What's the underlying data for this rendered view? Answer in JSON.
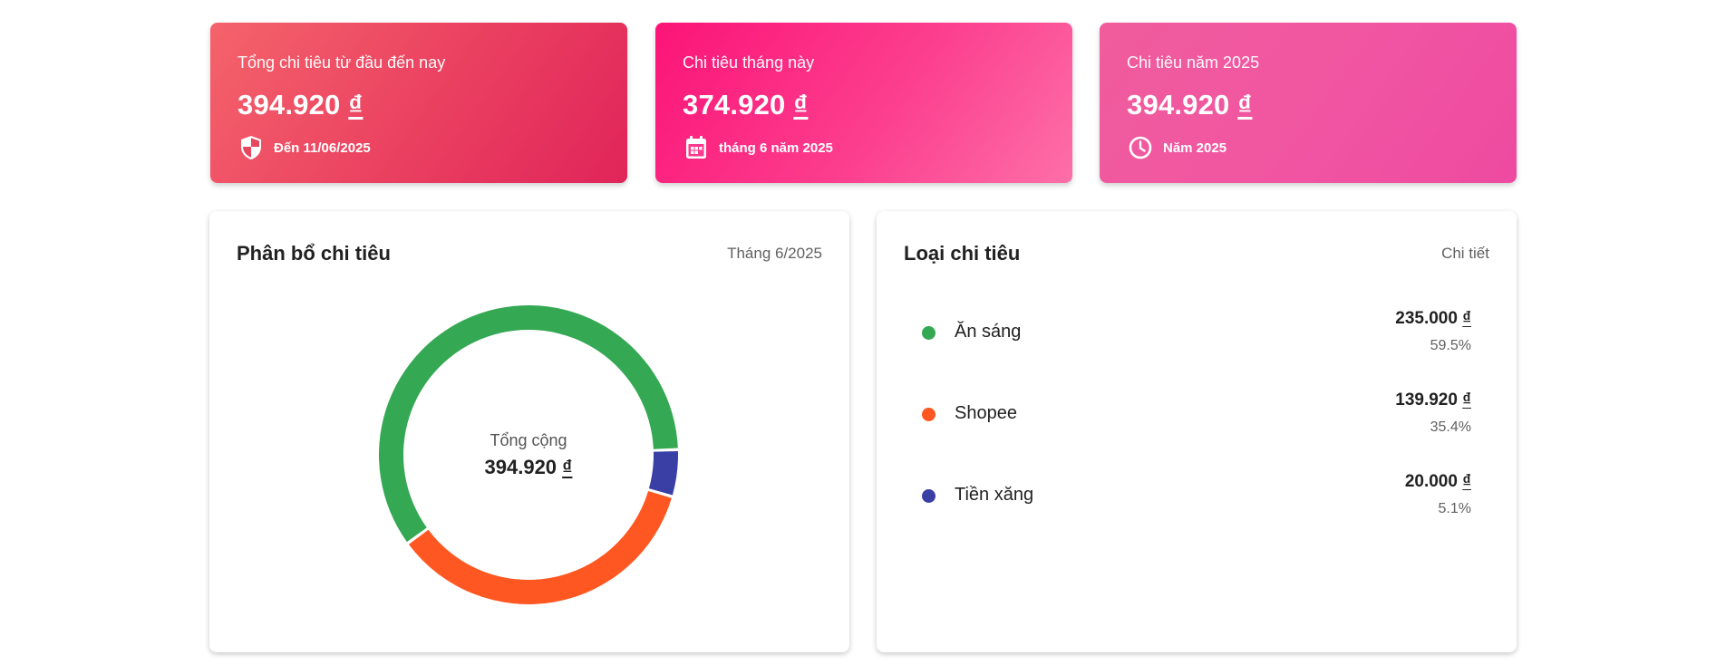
{
  "colors": {
    "an_sang": "#34a853",
    "shopee": "#ff5722",
    "tien_xang": "#3a3fa5"
  },
  "cards": {
    "total": {
      "label": "Tổng chi tiêu từ đầu đến nay",
      "amount": "394.920",
      "currency": "₫",
      "sub": "Đến 11/06/2025",
      "icon": "shield-icon"
    },
    "month": {
      "label": "Chi tiêu tháng này",
      "amount": "374.920",
      "currency": "₫",
      "sub": "tháng 6 năm 2025",
      "icon": "calendar-icon"
    },
    "year": {
      "label": "Chi tiêu năm 2025",
      "amount": "394.920",
      "currency": "₫",
      "sub": "Năm 2025",
      "icon": "clock-icon"
    }
  },
  "distribution": {
    "title": "Phân bổ chi tiêu",
    "period": "Tháng 6/2025",
    "center_label": "Tổng cộng",
    "center_amount": "394.920",
    "currency": "₫"
  },
  "types": {
    "title": "Loại chi tiêu",
    "detail_link": "Chi tiết",
    "items": [
      {
        "name": "Ăn sáng",
        "amount": "235.000",
        "currency": "₫",
        "percent": "59.5%"
      },
      {
        "name": "Shopee",
        "amount": "139.920",
        "currency": "₫",
        "percent": "35.4%"
      },
      {
        "name": "Tiền xăng",
        "amount": "20.000",
        "currency": "₫",
        "percent": "5.1%"
      }
    ]
  },
  "chart_data": {
    "type": "pie",
    "categories": [
      "Ăn sáng",
      "Shopee",
      "Tiền xăng"
    ],
    "values": [
      235000,
      139920,
      20000
    ],
    "colors": [
      "#34a853",
      "#ff5722",
      "#3a3fa5"
    ],
    "donut": true
  }
}
